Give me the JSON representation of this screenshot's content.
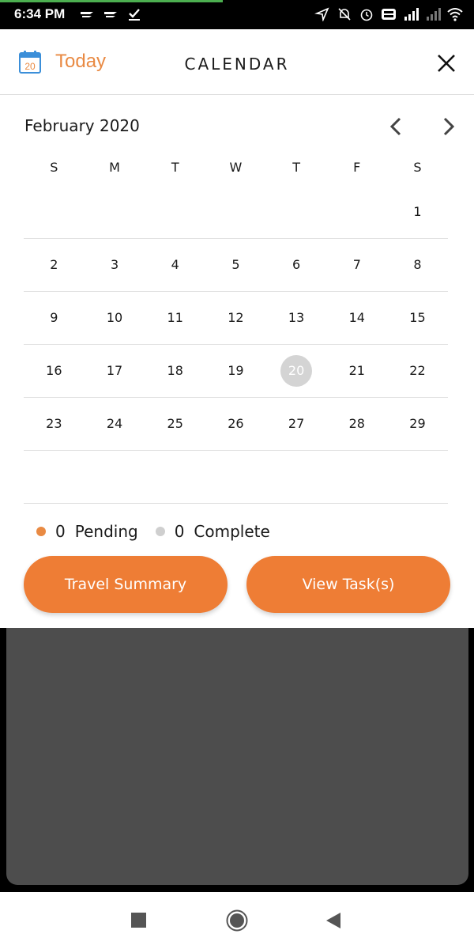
{
  "status_bar": {
    "time": "6:34 PM"
  },
  "header": {
    "today_icon_day": "20",
    "today_label": "Today",
    "title": "CALENDAR"
  },
  "calendar": {
    "month_title": "February 2020",
    "weekdays": [
      "S",
      "M",
      "T",
      "W",
      "T",
      "F",
      "S"
    ],
    "weeks": [
      [
        "",
        "",
        "",
        "",
        "",
        "",
        "1"
      ],
      [
        "2",
        "3",
        "4",
        "5",
        "6",
        "7",
        "8"
      ],
      [
        "9",
        "10",
        "11",
        "12",
        "13",
        "14",
        "15"
      ],
      [
        "16",
        "17",
        "18",
        "19",
        "20",
        "21",
        "22"
      ],
      [
        "23",
        "24",
        "25",
        "26",
        "27",
        "28",
        "29"
      ],
      [
        "",
        "",
        "",
        "",
        "",
        "",
        ""
      ]
    ],
    "selected_day": "20"
  },
  "legend": {
    "pending_count": "0",
    "pending_label": "Pending",
    "complete_count": "0",
    "complete_label": "Complete"
  },
  "actions": {
    "travel_summary": "Travel Summary",
    "view_tasks": "View Task(s)"
  },
  "colors": {
    "accent": "#ee7d35",
    "pending_dot": "#e98a43",
    "complete_dot": "#cfcfcf",
    "selected_day_bg": "#d4d4d4"
  }
}
